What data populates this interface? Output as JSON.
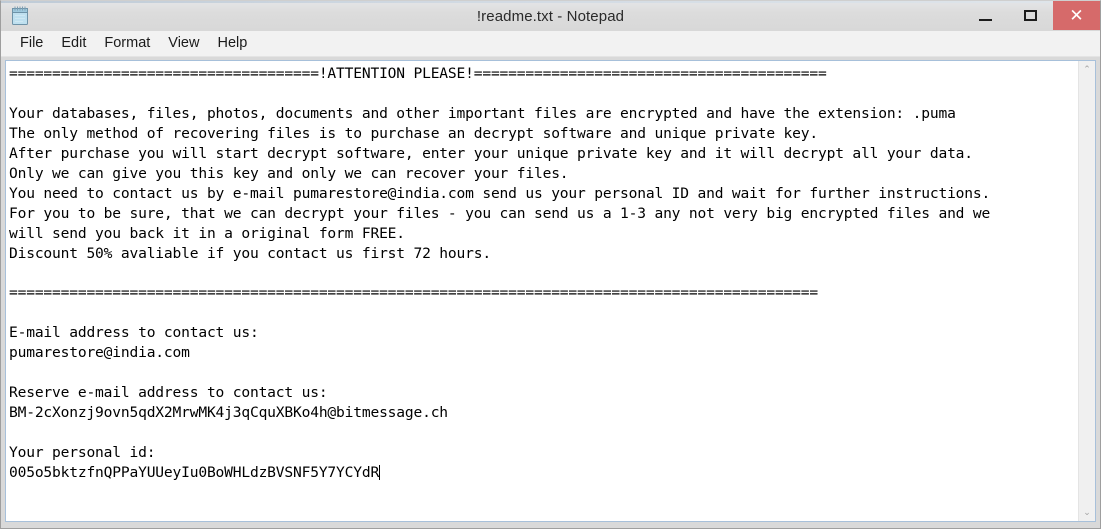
{
  "window": {
    "title": "!readme.txt - Notepad",
    "icon": "notepad-icon",
    "controls": {
      "minimize_label": "—",
      "maximize_label": "□",
      "close_label": "✕",
      "close_color": "#d66a6a"
    }
  },
  "menu": {
    "items": [
      {
        "label": "File"
      },
      {
        "label": "Edit"
      },
      {
        "label": "Format"
      },
      {
        "label": "View"
      },
      {
        "label": "Help"
      }
    ]
  },
  "scrollbar": {
    "up_arrow": "⌃",
    "down_arrow": "⌄"
  },
  "document": {
    "filename": "!readme.txt",
    "encryption_extension": ".puma",
    "contact_email": "pumarestore@india.com",
    "reserve_email": "BM-2cXonzj9ovn5qdX2MrwMK4j3qCquXBKo4h@bitmessage.ch",
    "personal_id": "005o5bktzfnQPPaYUUeyIu0BoWHLdzBVSNF5Y7YCYdR",
    "discount": "50%",
    "discount_window_hours": "72",
    "lines": [
      "====================================!ATTENTION PLEASE!=========================================",
      "",
      "Your databases, files, photos, documents and other important files are encrypted and have the extension: .puma",
      "The only method of recovering files is to purchase an decrypt software and unique private key.",
      "After purchase you will start decrypt software, enter your unique private key and it will decrypt all your data.",
      "Only we can give you this key and only we can recover your files.",
      "You need to contact us by e-mail pumarestore@india.com send us your personal ID and wait for further instructions.",
      "For you to be sure, that we can decrypt your files - you can send us a 1-3 any not very big encrypted files and we",
      "will send you back it in a original form FREE.",
      "Discount 50% avaliable if you contact us first 72 hours.",
      "",
      "==============================================================================================",
      "",
      "E-mail address to contact us:",
      "pumarestore@india.com",
      "",
      "Reserve e-mail address to contact us:",
      "BM-2cXonzj9ovn5qdX2MrwMK4j3qCquXBKo4h@bitmessage.ch",
      "",
      "Your personal id:",
      "005o5bktzfnQPPaYUUeyIu0BoWHLdzBVSNF5Y7YCYdR"
    ],
    "text": "====================================!ATTENTION PLEASE!=========================================\n\nYour databases, files, photos, documents and other important files are encrypted and have the extension: .puma\nThe only method of recovering files is to purchase an decrypt software and unique private key.\nAfter purchase you will start decrypt software, enter your unique private key and it will decrypt all your data.\nOnly we can give you this key and only we can recover your files.\nYou need to contact us by e-mail pumarestore@india.com send us your personal ID and wait for further instructions.\nFor you to be sure, that we can decrypt your files - you can send us a 1-3 any not very big encrypted files and we\nwill send you back it in a original form FREE.\nDiscount 50% avaliable if you contact us first 72 hours.\n\n==============================================================================================\n\nE-mail address to contact us:\npumarestore@india.com\n\nReserve e-mail address to contact us:\nBM-2cXonzj9ovn5qdX2MrwMK4j3qCquXBKo4h@bitmessage.ch\n\nYour personal id:\n005o5bktzfnQPPaYUUeyIu0BoWHLdzBVSNF5Y7YCYdR"
  }
}
